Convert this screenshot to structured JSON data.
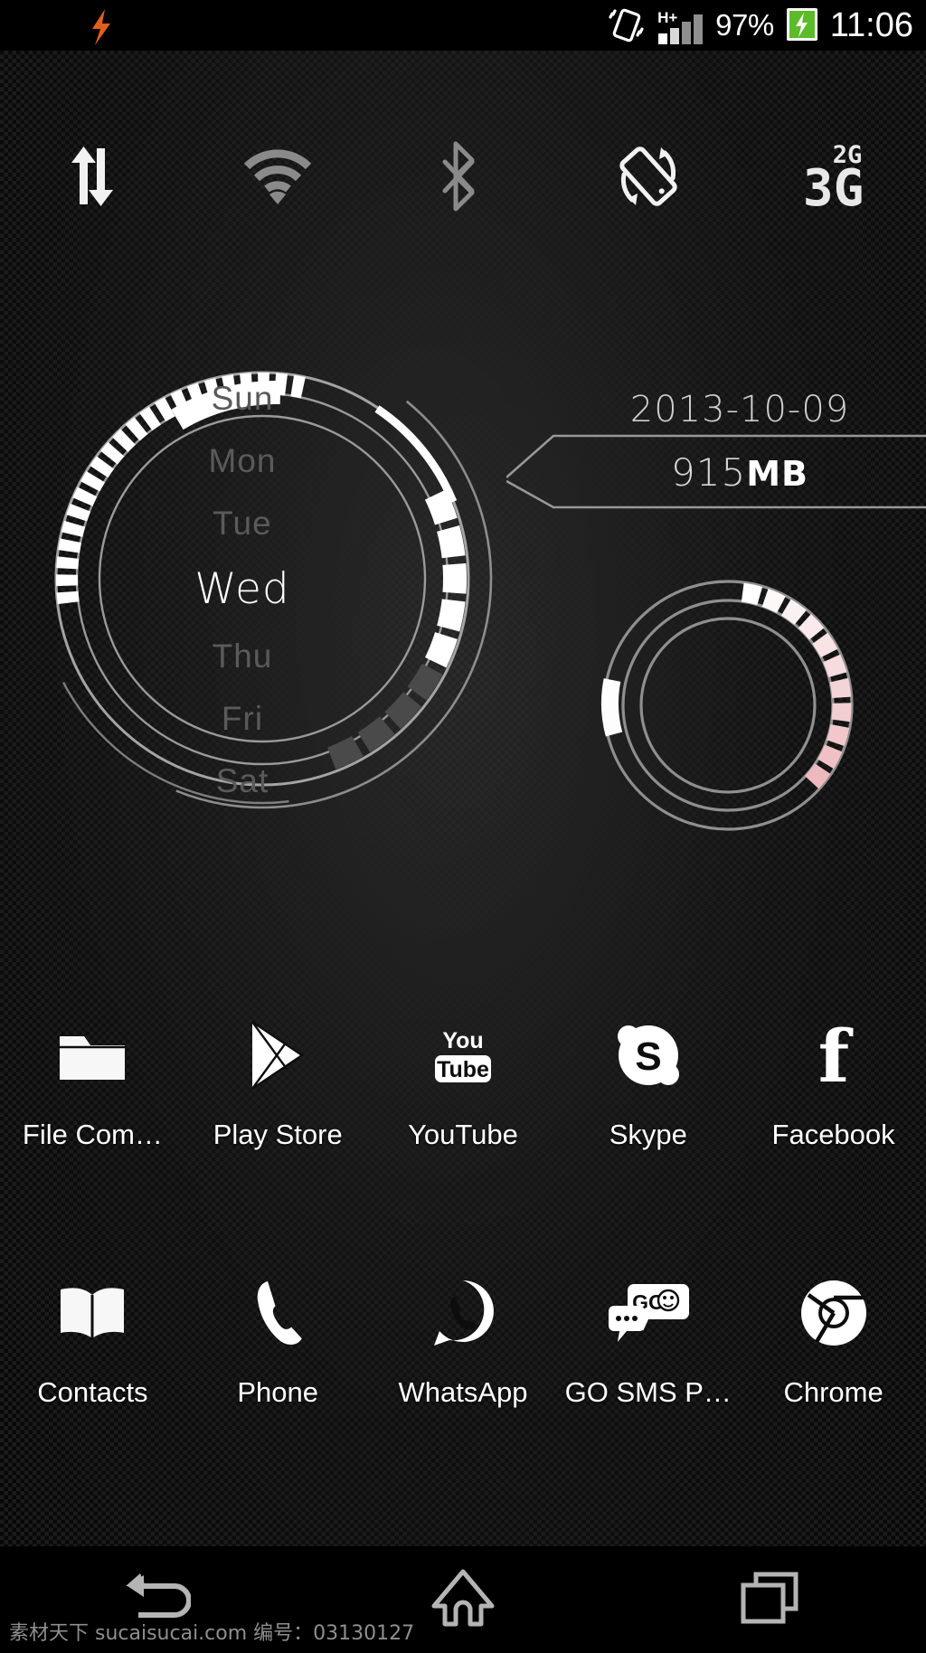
{
  "statusbar": {
    "left_icon": "flash-icon",
    "shake_icon": "shake-gesture-icon",
    "network_type": "H+",
    "signal_icon": "signal-bars-icon",
    "battery_percent": "97%",
    "battery_icon": "battery-charging-icon",
    "clock": "11:06"
  },
  "toggles": [
    {
      "name": "data-sync-toggle",
      "icon": "data-transfer-arrows-icon",
      "state": "on"
    },
    {
      "name": "wifi-toggle",
      "icon": "wifi-icon",
      "state": "off"
    },
    {
      "name": "bluetooth-toggle",
      "icon": "bluetooth-icon",
      "state": "off"
    },
    {
      "name": "rotation-toggle",
      "icon": "screen-rotation-icon",
      "state": "on"
    },
    {
      "name": "network-mode-toggle",
      "icon": "2g-3g-icon",
      "state": "on",
      "top_label": "2G",
      "main_label": "3G"
    }
  ],
  "clock_widget": {
    "days": [
      "Sun",
      "Mon",
      "Tue",
      "Wed",
      "Thu",
      "Fri",
      "Sat"
    ],
    "active_day": "Wed",
    "active_index": 3,
    "date": "2013-10-09",
    "memory_value": "915",
    "memory_unit": "MB",
    "colors": {
      "ring_line": "#9a9a9a",
      "segment_on": "#ffffff",
      "segment_off": "#4a4a4a",
      "day_inactive": "#5a5a5a",
      "day_active": "#ffffff",
      "accent_pink": "#edb9bd"
    }
  },
  "apps": {
    "row1": [
      {
        "label": "File Com…",
        "icon": "folder-icon"
      },
      {
        "label": "Play Store",
        "icon": "play-store-icon"
      },
      {
        "label": "YouTube",
        "icon": "youtube-icon"
      },
      {
        "label": "Skype",
        "icon": "skype-icon"
      },
      {
        "label": "Facebook",
        "icon": "facebook-icon"
      }
    ],
    "row2": [
      {
        "label": "Contacts",
        "icon": "address-book-icon"
      },
      {
        "label": "Phone",
        "icon": "phone-handset-icon"
      },
      {
        "label": "WhatsApp",
        "icon": "whatsapp-icon"
      },
      {
        "label": "GO SMS P…",
        "icon": "go-sms-icon"
      },
      {
        "label": "Chrome",
        "icon": "chrome-icon"
      }
    ]
  },
  "navbar": [
    {
      "name": "back-button",
      "icon": "back-arrow-icon"
    },
    {
      "name": "home-button",
      "icon": "home-icon"
    },
    {
      "name": "recents-button",
      "icon": "recent-apps-icon"
    }
  ],
  "watermark": "素材天下 sucaisucai.com 编号：03130127"
}
